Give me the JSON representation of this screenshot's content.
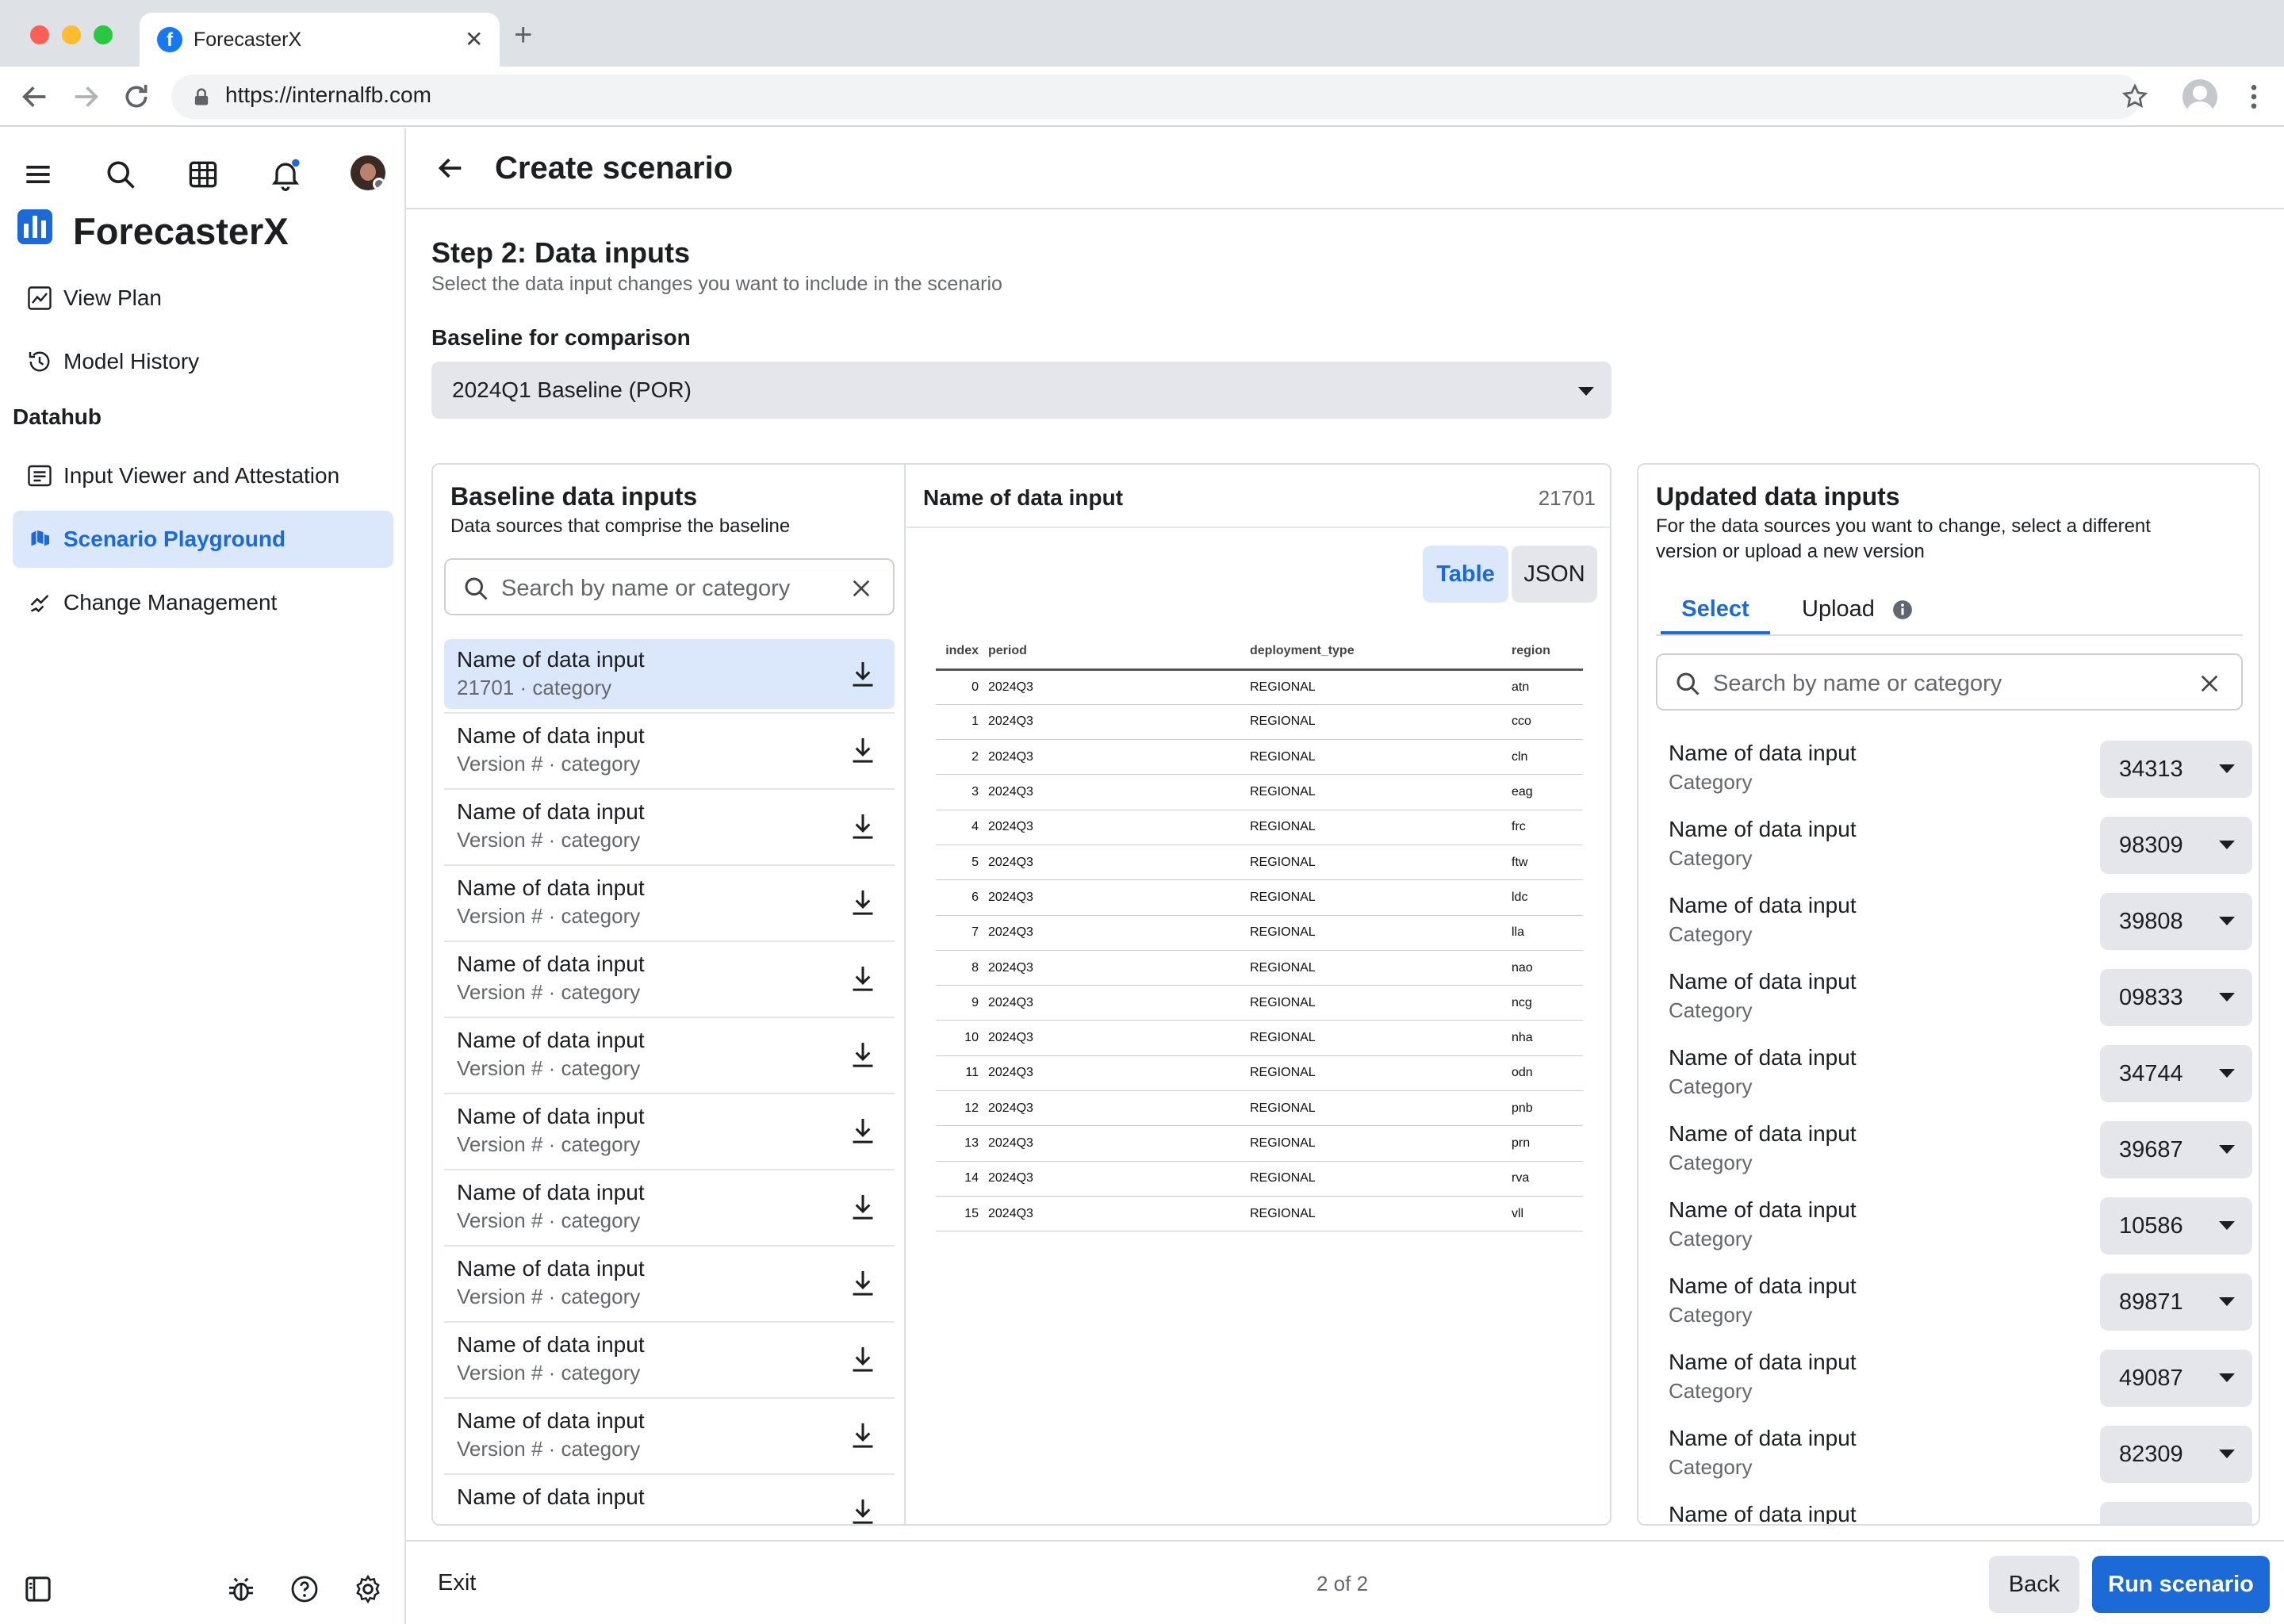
{
  "browser": {
    "tab_title": "ForecasterX",
    "url": "https://internalfb.com"
  },
  "sidebar": {
    "app_name": "ForecasterX",
    "nav": [
      {
        "label": "View Plan",
        "icon": "trend-chart-icon"
      },
      {
        "label": "Model History",
        "icon": "history-icon"
      }
    ],
    "section": "Datahub",
    "datahub_nav": [
      {
        "label": "Input Viewer and Attestation",
        "icon": "list-doc-icon"
      },
      {
        "label": "Scenario Playground",
        "icon": "playground-icon",
        "active": true
      },
      {
        "label": "Change Management",
        "icon": "change-icon"
      }
    ]
  },
  "header": {
    "title": "Create scenario"
  },
  "step": {
    "title": "Step 2: Data inputs",
    "subtitle": "Select the data input changes you want to include in the scenario",
    "baseline_label": "Baseline for comparison",
    "baseline_value": "2024Q1 Baseline (POR)"
  },
  "baseline_panel": {
    "title": "Baseline data inputs",
    "subtitle": "Data sources that comprise the baseline",
    "search_placeholder": "Search by name or category",
    "items": [
      {
        "name": "Name of data input",
        "meta": "21701 · category",
        "selected": true
      },
      {
        "name": "Name of data input",
        "meta": "Version # · category"
      },
      {
        "name": "Name of data input",
        "meta": "Version # · category"
      },
      {
        "name": "Name of data input",
        "meta": "Version # · category"
      },
      {
        "name": "Name of data input",
        "meta": "Version # · category"
      },
      {
        "name": "Name of data input",
        "meta": "Version # · category"
      },
      {
        "name": "Name of data input",
        "meta": "Version # · category"
      },
      {
        "name": "Name of data input",
        "meta": "Version # · category"
      },
      {
        "name": "Name of data input",
        "meta": "Version # · category"
      },
      {
        "name": "Name of data input",
        "meta": "Version # · category"
      },
      {
        "name": "Name of data input",
        "meta": "Version # · category"
      },
      {
        "name": "Name of data input",
        "meta": ""
      }
    ]
  },
  "preview_panel": {
    "title": "Name of data input",
    "version": "21701",
    "view_toggle": {
      "table": "Table",
      "json": "JSON",
      "active": "table"
    },
    "columns": [
      "index",
      "period",
      "deployment_type",
      "region"
    ],
    "rows": [
      [
        "0",
        "2024Q3",
        "REGIONAL",
        "atn"
      ],
      [
        "1",
        "2024Q3",
        "REGIONAL",
        "cco"
      ],
      [
        "2",
        "2024Q3",
        "REGIONAL",
        "cln"
      ],
      [
        "3",
        "2024Q3",
        "REGIONAL",
        "eag"
      ],
      [
        "4",
        "2024Q3",
        "REGIONAL",
        "frc"
      ],
      [
        "5",
        "2024Q3",
        "REGIONAL",
        "ftw"
      ],
      [
        "6",
        "2024Q3",
        "REGIONAL",
        "ldc"
      ],
      [
        "7",
        "2024Q3",
        "REGIONAL",
        "lla"
      ],
      [
        "8",
        "2024Q3",
        "REGIONAL",
        "nao"
      ],
      [
        "9",
        "2024Q3",
        "REGIONAL",
        "ncg"
      ],
      [
        "10",
        "2024Q3",
        "REGIONAL",
        "nha"
      ],
      [
        "11",
        "2024Q3",
        "REGIONAL",
        "odn"
      ],
      [
        "12",
        "2024Q3",
        "REGIONAL",
        "pnb"
      ],
      [
        "13",
        "2024Q3",
        "REGIONAL",
        "prn"
      ],
      [
        "14",
        "2024Q3",
        "REGIONAL",
        "rva"
      ],
      [
        "15",
        "2024Q3",
        "REGIONAL",
        "vll"
      ]
    ]
  },
  "updated_panel": {
    "title": "Updated data inputs",
    "subtitle_line1": "For the data sources you want to change, select a different",
    "subtitle_line2": "version or upload a new version",
    "tabs": [
      {
        "label": "Select",
        "active": true
      },
      {
        "label": "Upload"
      }
    ],
    "search_placeholder": "Search by name or category",
    "items": [
      {
        "name": "Name of data input",
        "category": "Category",
        "version": "34313"
      },
      {
        "name": "Name of data input",
        "category": "Category",
        "version": "98309"
      },
      {
        "name": "Name of data input",
        "category": "Category",
        "version": "39808"
      },
      {
        "name": "Name of data input",
        "category": "Category",
        "version": "09833"
      },
      {
        "name": "Name of data input",
        "category": "Category",
        "version": "34744"
      },
      {
        "name": "Name of data input",
        "category": "Category",
        "version": "39687"
      },
      {
        "name": "Name of data input",
        "category": "Category",
        "version": "10586"
      },
      {
        "name": "Name of data input",
        "category": "Category",
        "version": "89871"
      },
      {
        "name": "Name of data input",
        "category": "Category",
        "version": "49087"
      },
      {
        "name": "Name of data input",
        "category": "Category",
        "version": "82309"
      },
      {
        "name": "Name of data input",
        "category": "",
        "version": ""
      }
    ]
  },
  "footer": {
    "exit": "Exit",
    "pager": "2 of 2",
    "back": "Back",
    "run": "Run scenario"
  },
  "colors": {
    "accent": "#1b6ad8",
    "selected_bg": "#dbe7fb",
    "button_gray": "#e4e6eb"
  }
}
